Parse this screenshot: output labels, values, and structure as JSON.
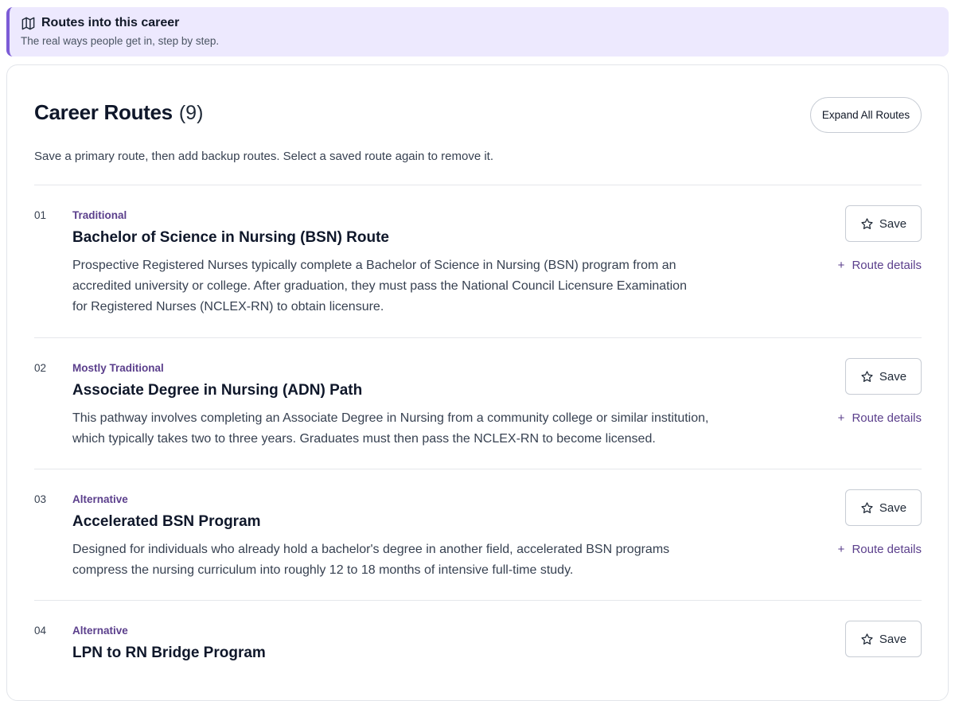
{
  "banner": {
    "title": "Routes into this career",
    "subtitle": "The real ways people get in, step by step."
  },
  "routes_section": {
    "title": "Career Routes",
    "count": "(9)",
    "expand_label": "Expand All Routes",
    "description": "Save a primary route, then add backup routes. Select a saved route again to remove it.",
    "save_label": "Save",
    "details_plus": "+",
    "details_label": "Route details"
  },
  "routes": [
    {
      "num": "01",
      "tag": "Traditional",
      "title": "Bachelor of Science in Nursing (BSN) Route",
      "text": "Prospective Registered Nurses typically complete a Bachelor of Science in Nursing (BSN) program from an accredited university or college. After graduation, they must pass the National Council Licensure Examination for Registered Nurses (NCLEX-RN) to obtain licensure."
    },
    {
      "num": "02",
      "tag": "Mostly Traditional",
      "title": "Associate Degree in Nursing (ADN) Path",
      "text": "This pathway involves completing an Associate Degree in Nursing from a community college or similar institution, which typically takes two to three years. Graduates must then pass the NCLEX-RN to become licensed."
    },
    {
      "num": "03",
      "tag": "Alternative",
      "title": "Accelerated BSN Program",
      "text": "Designed for individuals who already hold a bachelor's degree in another field, accelerated BSN programs compress the nursing curriculum into roughly 12 to 18 months of intensive full-time study."
    },
    {
      "num": "04",
      "tag": "Alternative",
      "title": "LPN to RN Bridge Program",
      "text": ""
    }
  ],
  "colors": {
    "accent": "#5b3f8c",
    "banner_bg": "#ede9fe",
    "banner_border": "#7c5cd6"
  },
  "icons": {
    "banner": "map-icon",
    "save": "star-outline-icon"
  }
}
